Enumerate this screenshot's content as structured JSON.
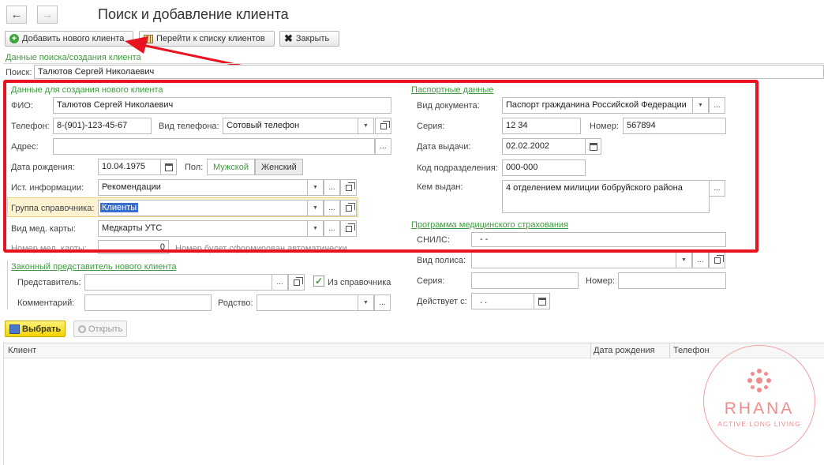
{
  "header": {
    "back_icon": "arrow-left-icon",
    "forward_icon": "arrow-right-icon",
    "title": "Поиск и добавление клиента"
  },
  "toolbar": {
    "add_label": "Добавить нового клиента",
    "list_label": "Перейти к списку клиентов",
    "close_label": "Закрыть"
  },
  "search": {
    "section_title": "Данные поиска/создания клиента",
    "label": "Поиск:",
    "value": "Талютов Сергей Николаевич"
  },
  "new_client": {
    "section_title": "Данные для создания нового клиента",
    "fio_label": "ФИО:",
    "fio_value": "Талютов Сергей Николаевич",
    "phone_label": "Телефон:",
    "phone_value": "8-(901)-123-45-67",
    "phone_type_label": "Вид телефона:",
    "phone_type_value": "Сотовый телефон",
    "address_label": "Адрес:",
    "address_value": "",
    "birth_label": "Дата рождения:",
    "birth_value": "10.04.1975",
    "gender_label": "Пол:",
    "gender_male": "Мужской",
    "gender_female": "Женский",
    "gender_selected": "Мужской",
    "source_label": "Ист. информации:",
    "source_value": "Рекомендации",
    "group_label": "Группа справочника:",
    "group_value": "Клиенты",
    "card_type_label": "Вид мед. карты:",
    "card_type_value": "Медкарты УТС",
    "card_number_label": "Номер мед. карты:",
    "card_number_value": "0",
    "card_number_note": "Номер будет сформирован автоматически"
  },
  "passport": {
    "section_title": "Паспортные данные",
    "doc_type_label": "Вид документа:",
    "doc_type_value": "Паспорт гражданина Российской Федерации",
    "series_label": "Серия:",
    "series_value": "12 34",
    "number_label": "Номер:",
    "number_value": "567894",
    "issue_date_label": "Дата выдачи:",
    "issue_date_value": "02.02.2002",
    "dept_code_label": "Код подразделения:",
    "dept_code_value": "000-000",
    "issued_by_label": "Кем выдан:",
    "issued_by_value": "4 отделением милиции бобруйского района"
  },
  "insurance": {
    "section_title": "Программа медицинского страхования",
    "snils_label": "СНИЛС:",
    "snils_value": "-   -",
    "policy_type_label": "Вид полиса:",
    "policy_type_value": "",
    "series_label": "Серия:",
    "series_value": "",
    "number_label": "Номер:",
    "number_value": "",
    "valid_from_label": "Действует с:",
    "valid_from_value": ".   ."
  },
  "representative": {
    "section_title": "Законный представитель нового клиента",
    "rep_label": "Представитель:",
    "rep_value": "",
    "from_directory_label": "Из справочника",
    "from_directory_checked": true,
    "comment_label": "Комментарий:",
    "comment_value": "",
    "relation_label": "Родство:",
    "relation_value": ""
  },
  "actions": {
    "select_label": "Выбрать",
    "open_label": "Открыть"
  },
  "table": {
    "columns": [
      "Клиент",
      "Дата рождения",
      "Телефон"
    ],
    "rows": []
  },
  "watermark": {
    "brand": "RHANA",
    "tagline": "ACTIVE LONG LIVING"
  },
  "colors": {
    "accent_green": "#3e9b3e",
    "annotation_red": "#e8131f",
    "select_yellow": "#f2d300",
    "group_highlight": "#f5d77a",
    "watermark": "#f08c8c"
  }
}
